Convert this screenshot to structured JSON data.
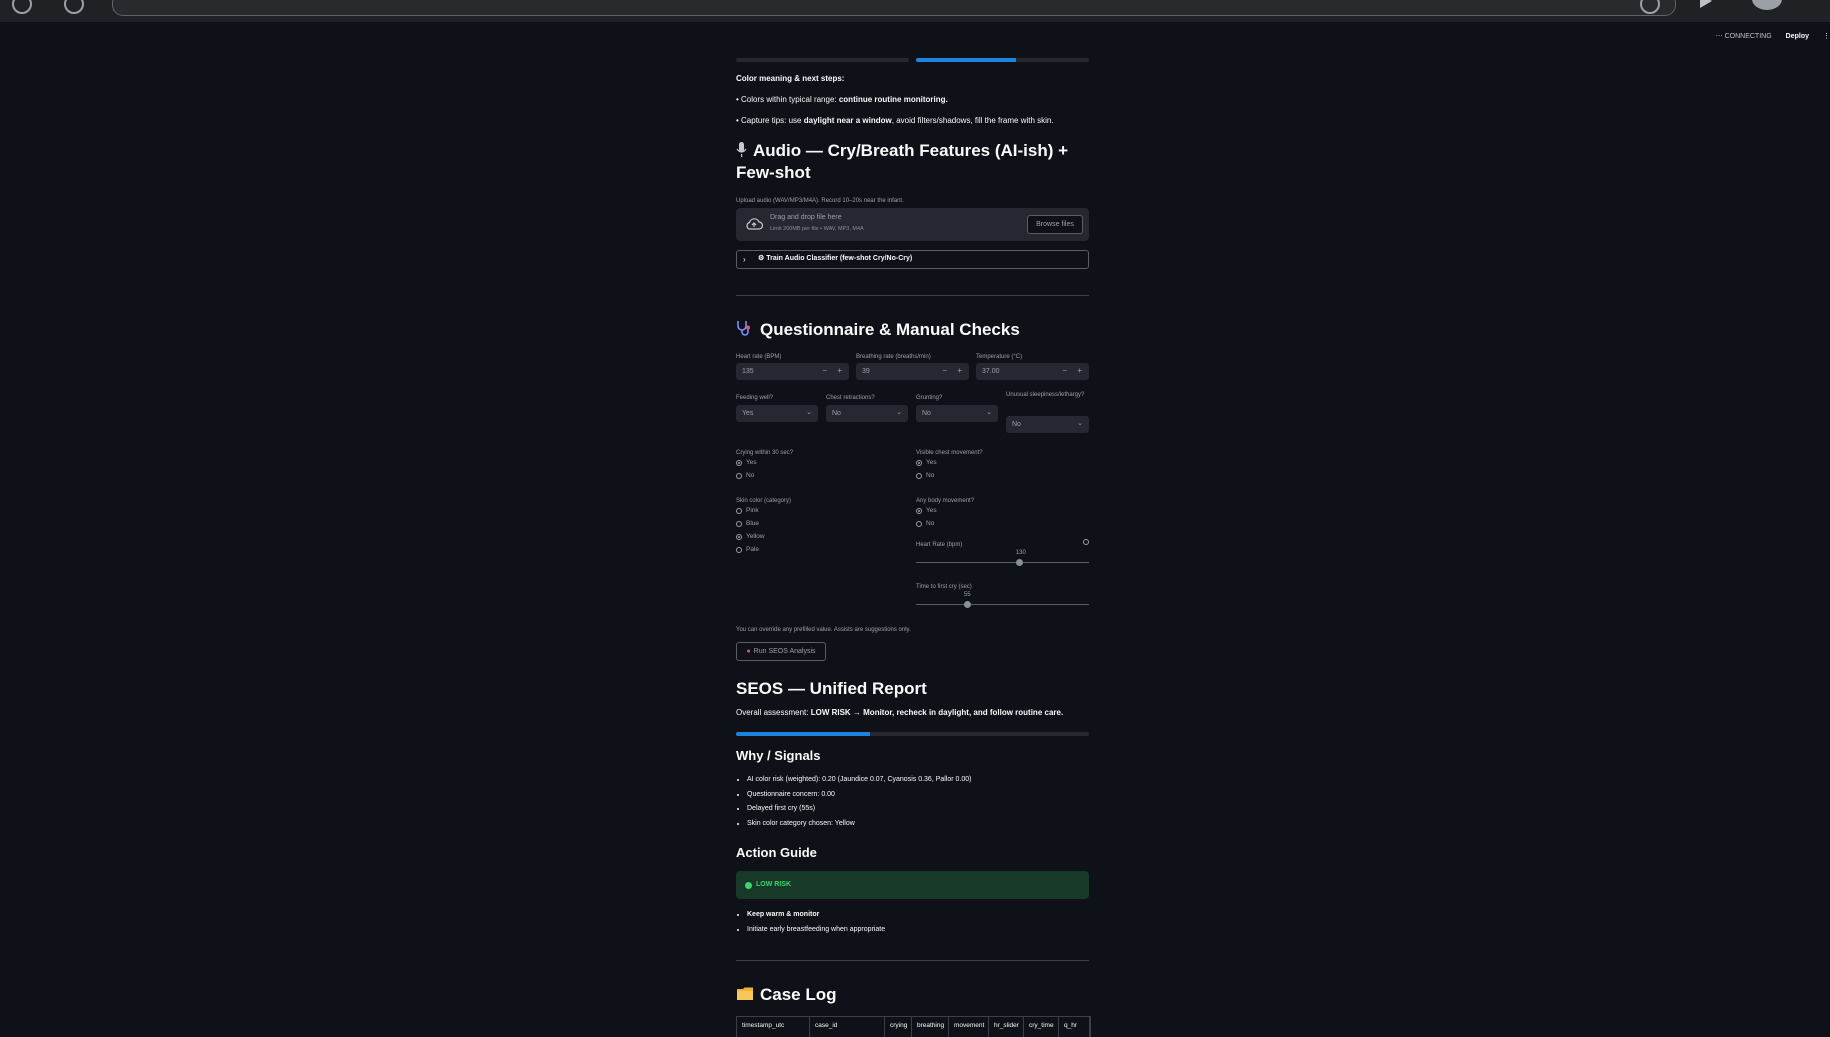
{
  "status": {
    "connecting": "CONNECTING",
    "deploy": "Deploy"
  },
  "progress": {
    "top_fraction": 0.58,
    "report_fraction": 0.38
  },
  "color_meaning": {
    "title": "Color meaning & next steps:",
    "line1_prefix": "• Colors within typical range: ",
    "line1_bold": "continue routine monitoring.",
    "line2_prefix": "• Capture tips: use ",
    "line2_bold": "daylight near a window",
    "line2_suffix": ", avoid filters/shadows, fill the frame with skin."
  },
  "audio": {
    "heading": "Audio — Cry/Breath Features (AI-ish) + Few-shot",
    "upload_label": "Upload audio (WAV/MP3/M4A). Record 10–20s near the infant.",
    "drag_text": "Drag and drop file here",
    "limit_text": "Limit 200MB per file • WAV, MP3, M4A",
    "browse_label": "Browse files",
    "expander_label": "Train Audio Classifier (few-shot Cry/No-Cry)"
  },
  "questionnaire": {
    "heading": "Questionnaire & Manual Checks",
    "heart_rate": {
      "label": "Heart rate (BPM)",
      "value": "135"
    },
    "breathing_rate": {
      "label": "Breathing rate (breaths/min)",
      "value": "39"
    },
    "temperature": {
      "label": "Temperature (°C)",
      "value": "37.00"
    },
    "feeding": {
      "label": "Feeding well?",
      "value": "Yes"
    },
    "retractions": {
      "label": "Chest retractions?",
      "value": "No"
    },
    "grunting": {
      "label": "Grunting?",
      "value": "No"
    },
    "sleepiness": {
      "label": "Unusual sleepiness/lethargy?",
      "value": "No"
    },
    "crying": {
      "label": "Crying within 30 sec?",
      "options": [
        "Yes",
        "No"
      ],
      "selected": "Yes"
    },
    "chest_movement": {
      "label": "Visible chest movement?",
      "options": [
        "Yes",
        "No"
      ],
      "selected": "Yes"
    },
    "skin_color": {
      "label": "Skin color (category)",
      "options": [
        "Pink",
        "Blue",
        "Yellow",
        "Pale"
      ],
      "selected": "Yellow"
    },
    "body_movement": {
      "label": "Any body movement?",
      "options": [
        "Yes",
        "No"
      ],
      "selected": "Yes"
    },
    "hr_slider": {
      "label": "Heart Rate (bpm)",
      "value": "130",
      "fraction": 0.6
    },
    "cry_slider": {
      "label": "Time to first cry (sec)",
      "value": "55",
      "fraction": 0.3
    },
    "note": "You can override any prefilled value. Assists are suggestions only.",
    "run_label": "Run SEOS Analysis"
  },
  "report": {
    "heading": "SEOS — Unified Report",
    "assessment_prefix": "Overall assessment: ",
    "assessment_bold": "LOW RISK → Monitor, recheck in daylight, and follow routine care.",
    "why_heading": "Why / Signals",
    "signals": [
      "AI color risk (weighted): 0.20 (Jaundice 0.07, Cyanosis 0.36, Pallor 0.00)",
      "Questionnaire concern: 0.00",
      "Delayed first cry (55s)",
      "Skin color category chosen: Yellow"
    ],
    "action_heading": "Action Guide",
    "risk_label": "LOW RISK",
    "actions": [
      "Keep warm & monitor",
      "Initiate early breastfeeding when appropriate"
    ]
  },
  "case_log": {
    "heading": "Case Log",
    "columns": [
      "timestamp_utc",
      "case_id",
      "crying",
      "breathing",
      "movement",
      "hr_slider",
      "cry_time",
      "q_hr"
    ]
  },
  "colors": {
    "accent": "#1c83e1",
    "success": "#3dd56d",
    "background": "#0e1117"
  }
}
